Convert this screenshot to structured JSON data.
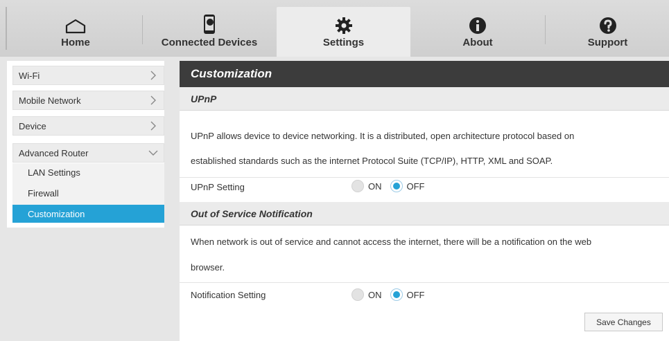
{
  "nav": {
    "tabs": [
      {
        "label": "Home",
        "icon": "home-icon"
      },
      {
        "label": "Connected Devices",
        "icon": "phone-icon"
      },
      {
        "label": "Settings",
        "icon": "gear-icon"
      },
      {
        "label": "About",
        "icon": "info-icon"
      },
      {
        "label": "Support",
        "icon": "question-icon"
      }
    ],
    "active_tab": "Settings"
  },
  "sidebar": {
    "items": [
      {
        "label": "Wi-Fi"
      },
      {
        "label": "Mobile Network"
      },
      {
        "label": "Device"
      },
      {
        "label": "Advanced Router"
      }
    ],
    "submenu": [
      {
        "label": "LAN Settings"
      },
      {
        "label": "Firewall"
      },
      {
        "label": "Customization"
      }
    ],
    "active_item": "Customization"
  },
  "main": {
    "title": "Customization",
    "upnp": {
      "heading": "UPnP",
      "desc_line1": "UPnP allows device to device networking. It is a distributed, open architecture protocol based on",
      "desc_line2": "established standards such as the internet Protocol Suite (TCP/IP), HTTP, XML and SOAP.",
      "setting_label": "UPnP Setting",
      "on_label": "ON",
      "off_label": "OFF",
      "value": "OFF"
    },
    "oos": {
      "heading": "Out of Service Notification",
      "desc_line1": "When network is out of service and cannot access the internet, there will be a notification on the web",
      "desc_line2": "browser.",
      "setting_label": "Notification Setting",
      "on_label": "ON",
      "off_label": "OFF",
      "value": "OFF"
    },
    "save_label": "Save Changes"
  },
  "colors": {
    "accent": "#25a2d6",
    "header_dark": "#3c3c3c"
  }
}
